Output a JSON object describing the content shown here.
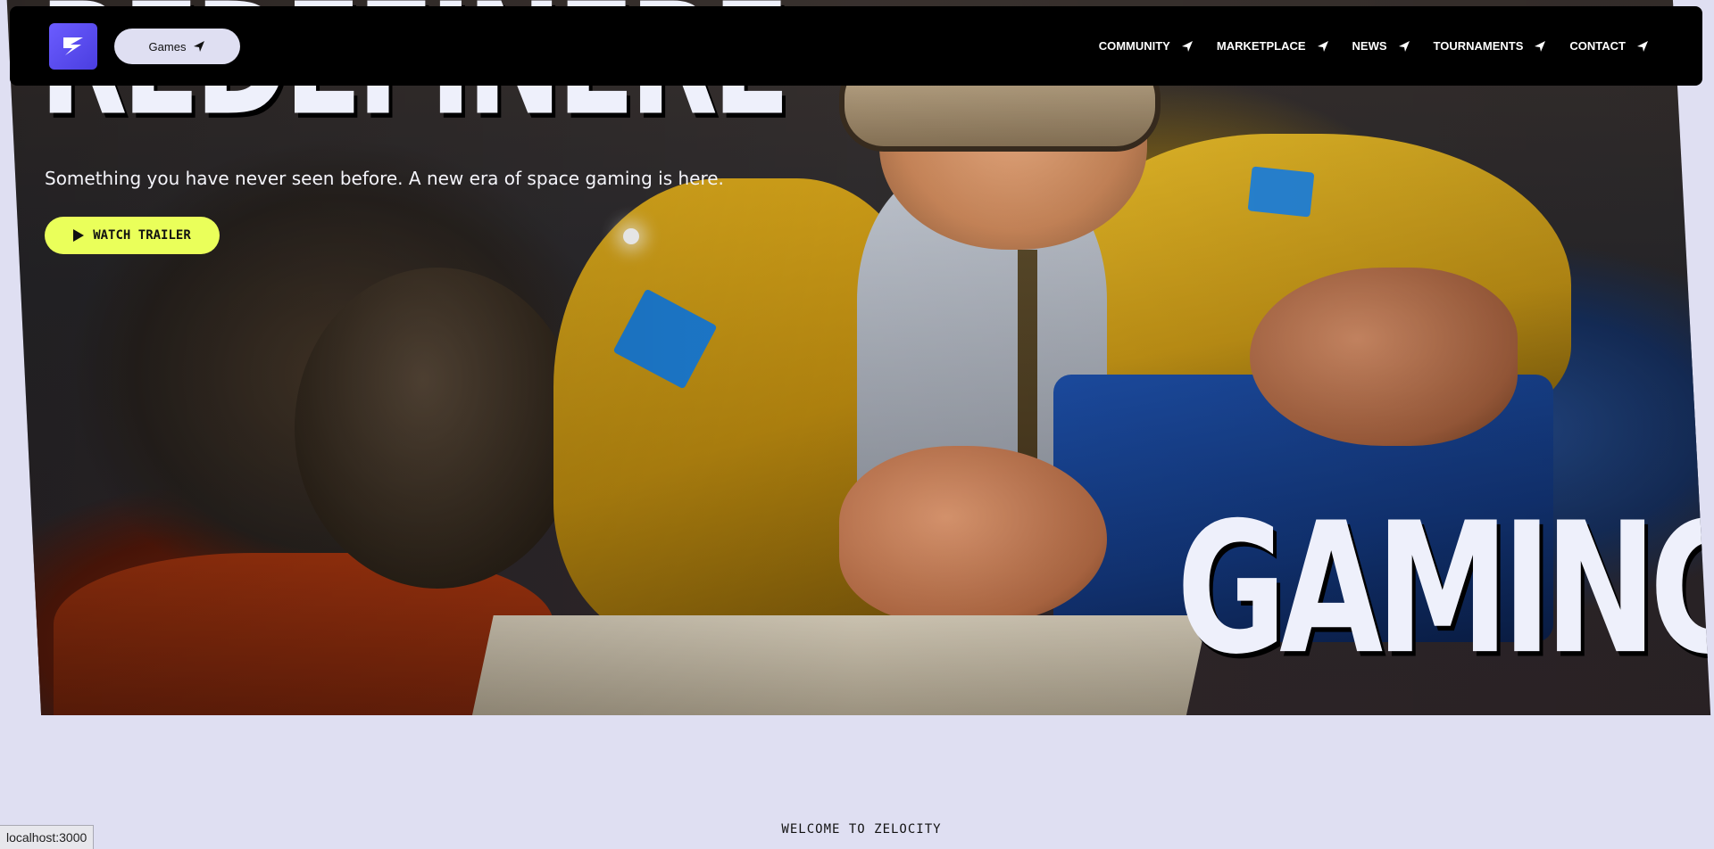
{
  "navbar": {
    "logo_icon": "zelocity-logo-icon",
    "games_label": "Games",
    "links": [
      {
        "label": "COMMUNITY",
        "icon": "arrow-icon"
      },
      {
        "label": "MARKETPLACE",
        "icon": "arrow-icon"
      },
      {
        "label": "NEWS",
        "icon": "arrow-icon"
      },
      {
        "label": "TOURNAMENTS",
        "icon": "arrow-icon"
      },
      {
        "label": "CONTACT",
        "icon": "arrow-icon"
      }
    ]
  },
  "hero": {
    "headline_top": "REDEFINERE",
    "subtitle": "Something you have never seen before. A new era of space gaming is here.",
    "trailer_button": "WATCH TRAILER",
    "headline_bottom": "GAMING"
  },
  "section": {
    "welcome": "WELCOME TO ZELOCITY"
  },
  "status_bar": {
    "url": "localhost:3000"
  },
  "colors": {
    "accent_yellow": "#eaff5a",
    "logo_purple": "#5b4cf5",
    "page_bg": "#dfdff2",
    "navbar_bg": "#000000"
  }
}
